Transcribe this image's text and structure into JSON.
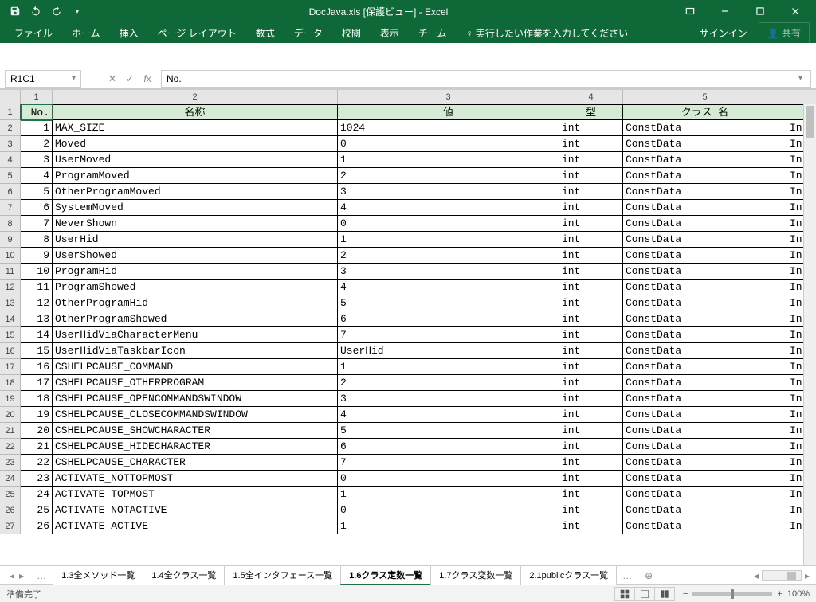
{
  "title": "DocJava.xls  [保護ビュー] - Excel",
  "ribbon": {
    "tabs": [
      "ファイル",
      "ホーム",
      "挿入",
      "ページ レイアウト",
      "数式",
      "データ",
      "校閲",
      "表示",
      "チーム"
    ],
    "tell": "実行したい作業を入力してください",
    "signin": "サインイン",
    "share": "共有"
  },
  "namebox": "R1C1",
  "formula": "No.",
  "col_numbers": [
    "1",
    "2",
    "3",
    "4",
    "5"
  ],
  "headers": [
    "No.",
    "名称",
    "値",
    "型",
    "クラス 名"
  ],
  "rows": [
    {
      "n": "1",
      "name": "MAX_SIZE",
      "val": "1024",
      "type": "int",
      "cls": "ConstData",
      "e": "In"
    },
    {
      "n": "2",
      "name": "Moved",
      "val": "0",
      "type": "int",
      "cls": "ConstData",
      "e": "In"
    },
    {
      "n": "3",
      "name": "UserMoved",
      "val": "1",
      "type": "int",
      "cls": "ConstData",
      "e": "In"
    },
    {
      "n": "4",
      "name": "ProgramMoved",
      "val": "2",
      "type": "int",
      "cls": "ConstData",
      "e": "In"
    },
    {
      "n": "5",
      "name": "OtherProgramMoved",
      "val": "3",
      "type": "int",
      "cls": "ConstData",
      "e": "In"
    },
    {
      "n": "6",
      "name": "SystemMoved",
      "val": "4",
      "type": "int",
      "cls": "ConstData",
      "e": "In"
    },
    {
      "n": "7",
      "name": "NeverShown",
      "val": "0",
      "type": "int",
      "cls": "ConstData",
      "e": "In"
    },
    {
      "n": "8",
      "name": "UserHid",
      "val": "1",
      "type": "int",
      "cls": "ConstData",
      "e": "In"
    },
    {
      "n": "9",
      "name": "UserShowed",
      "val": "2",
      "type": "int",
      "cls": "ConstData",
      "e": "In"
    },
    {
      "n": "10",
      "name": "ProgramHid",
      "val": "3",
      "type": "int",
      "cls": "ConstData",
      "e": "In"
    },
    {
      "n": "11",
      "name": "ProgramShowed",
      "val": "4",
      "type": "int",
      "cls": "ConstData",
      "e": "In"
    },
    {
      "n": "12",
      "name": "OtherProgramHid",
      "val": "5",
      "type": "int",
      "cls": "ConstData",
      "e": "In"
    },
    {
      "n": "13",
      "name": "OtherProgramShowed",
      "val": "6",
      "type": "int",
      "cls": "ConstData",
      "e": "In"
    },
    {
      "n": "14",
      "name": "UserHidViaCharacterMenu",
      "val": "7",
      "type": "int",
      "cls": "ConstData",
      "e": "In"
    },
    {
      "n": "15",
      "name": "UserHidViaTaskbarIcon",
      "val": "UserHid",
      "type": "int",
      "cls": "ConstData",
      "e": "In"
    },
    {
      "n": "16",
      "name": "CSHELPCAUSE_COMMAND",
      "val": "1",
      "type": "int",
      "cls": "ConstData",
      "e": "In"
    },
    {
      "n": "17",
      "name": "CSHELPCAUSE_OTHERPROGRAM",
      "val": "2",
      "type": "int",
      "cls": "ConstData",
      "e": "In"
    },
    {
      "n": "18",
      "name": "CSHELPCAUSE_OPENCOMMANDSWINDOW",
      "val": "3",
      "type": "int",
      "cls": "ConstData",
      "e": "In"
    },
    {
      "n": "19",
      "name": "CSHELPCAUSE_CLOSECOMMANDSWINDOW",
      "val": "4",
      "type": "int",
      "cls": "ConstData",
      "e": "In"
    },
    {
      "n": "20",
      "name": "CSHELPCAUSE_SHOWCHARACTER",
      "val": "5",
      "type": "int",
      "cls": "ConstData",
      "e": "In"
    },
    {
      "n": "21",
      "name": "CSHELPCAUSE_HIDECHARACTER",
      "val": "6",
      "type": "int",
      "cls": "ConstData",
      "e": "In"
    },
    {
      "n": "22",
      "name": "CSHELPCAUSE_CHARACTER",
      "val": "7",
      "type": "int",
      "cls": "ConstData",
      "e": "In"
    },
    {
      "n": "23",
      "name": "ACTIVATE_NOTTOPMOST",
      "val": "0",
      "type": "int",
      "cls": "ConstData",
      "e": "In"
    },
    {
      "n": "24",
      "name": "ACTIVATE_TOPMOST",
      "val": "1",
      "type": "int",
      "cls": "ConstData",
      "e": "In"
    },
    {
      "n": "25",
      "name": "ACTIVATE_NOTACTIVE",
      "val": "0",
      "type": "int",
      "cls": "ConstData",
      "e": "In"
    },
    {
      "n": "26",
      "name": "ACTIVATE_ACTIVE",
      "val": "1",
      "type": "int",
      "cls": "ConstData",
      "e": "In"
    }
  ],
  "sheets": {
    "pre": "…",
    "tabs": [
      "1.3全メソッド一覧",
      "1.4全クラス一覧",
      "1.5全インタフェース一覧",
      "1.6クラス定数一覧",
      "1.7クラス変数一覧",
      "2.1publicクラス一覧"
    ],
    "active": 3,
    "post": "…"
  },
  "status": {
    "ready": "準備完了",
    "zoom": "100%"
  }
}
